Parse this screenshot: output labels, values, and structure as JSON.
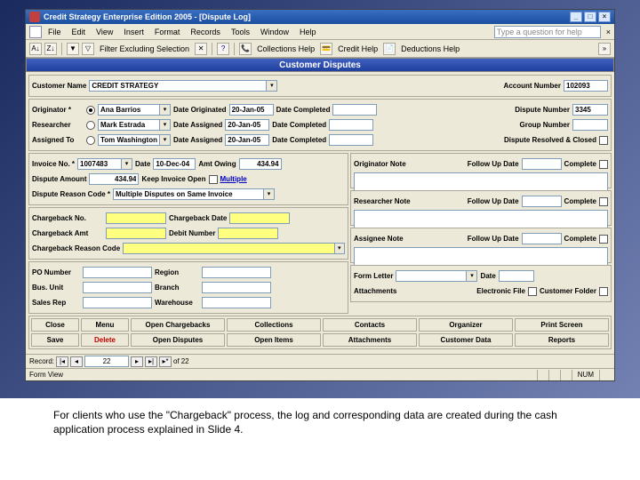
{
  "title": "Credit Strategy Enterprise Edition 2005 - [Dispute Log]",
  "menus": {
    "file": "File",
    "edit": "Edit",
    "view": "View",
    "insert": "Insert",
    "format": "Format",
    "records": "Records",
    "tools": "Tools",
    "window": "Window",
    "help": "Help"
  },
  "helpbox_placeholder": "Type a question for help",
  "toolbar": {
    "filter": "Filter Excluding Selection",
    "collections": "Collections Help",
    "credit": "Credit Help",
    "deductions": "Deductions Help"
  },
  "header": "Customer Disputes",
  "top": {
    "customer_name_lbl": "Customer Name",
    "customer_name": "CREDIT STRATEGY",
    "account_number_lbl": "Account Number",
    "account_number": "102093"
  },
  "orig": {
    "originator_lbl": "Originator *",
    "originator": "Ana Barrios",
    "date_originated_lbl": "Date Originated",
    "date_originated": "20-Jan-05",
    "date_completed_lbl": "Date Completed",
    "dispute_number_lbl": "Dispute Number",
    "dispute_number": "3345",
    "researcher_lbl": "Researcher",
    "researcher": "Mark Estrada",
    "date_assigned_lbl": "Date Assigned",
    "date_assigned1": "20-Jan-05",
    "group_number_lbl": "Group Number",
    "assigned_to_lbl": "Assigned To",
    "assigned_to": "Tom Washington",
    "date_assigned2": "20-Jan-05",
    "dispute_resolved_lbl": "Dispute Resolved & Closed"
  },
  "inv": {
    "invoice_no_lbl": "Invoice No. *",
    "invoice_no": "1007483",
    "date_lbl": "Date",
    "date": "10-Dec-04",
    "amt_owing_lbl": "Amt Owing",
    "amt_owing": "434.94",
    "dispute_amount_lbl": "Dispute Amount",
    "dispute_amount": "434.94",
    "keep_open_lbl": "Keep Invoice Open",
    "multiple": "Multiple",
    "reason_code_lbl": "Dispute Reason Code *",
    "reason_code": "Multiple Disputes on Same Invoice"
  },
  "notes": {
    "originator_note_lbl": "Originator Note",
    "researcher_note_lbl": "Researcher Note",
    "assignee_note_lbl": "Assignee Note",
    "follow_up_lbl": "Follow Up Date",
    "complete_lbl": "Complete"
  },
  "cb": {
    "no_lbl": "Chargeback No.",
    "date_lbl": "Chargeback Date",
    "amt_lbl": "Chargeback Amt",
    "debit_lbl": "Debit Number",
    "reason_lbl": "Chargeback Reason Code"
  },
  "misc": {
    "po_lbl": "PO Number",
    "region_lbl": "Region",
    "bus_lbl": "Bus. Unit",
    "branch_lbl": "Branch",
    "sales_lbl": "Sales Rep",
    "warehouse_lbl": "Warehouse",
    "form_letter_lbl": "Form Letter",
    "date_lbl": "Date",
    "attachments_lbl": "Attachments",
    "efile_lbl": "Electronic File",
    "folder_lbl": "Customer Folder"
  },
  "buttons": {
    "close": "Close",
    "menu": "Menu",
    "open_cb": "Open Chargebacks",
    "collections": "Collections",
    "contacts": "Contacts",
    "organizer": "Organizer",
    "print": "Print Screen",
    "save": "Save",
    "delete": "Delete",
    "open_disp": "Open Disputes",
    "open_items": "Open Items",
    "attachments": "Attachments",
    "cust_data": "Customer Data",
    "reports": "Reports"
  },
  "nav": {
    "record_lbl": "Record:",
    "current": "22",
    "of": "of",
    "total": "22"
  },
  "status": {
    "form_view": "Form View",
    "num": "NUM"
  },
  "caption": "For clients who use the \"Chargeback\" process, the log and corresponding data are created during the cash application process explained in Slide 4."
}
